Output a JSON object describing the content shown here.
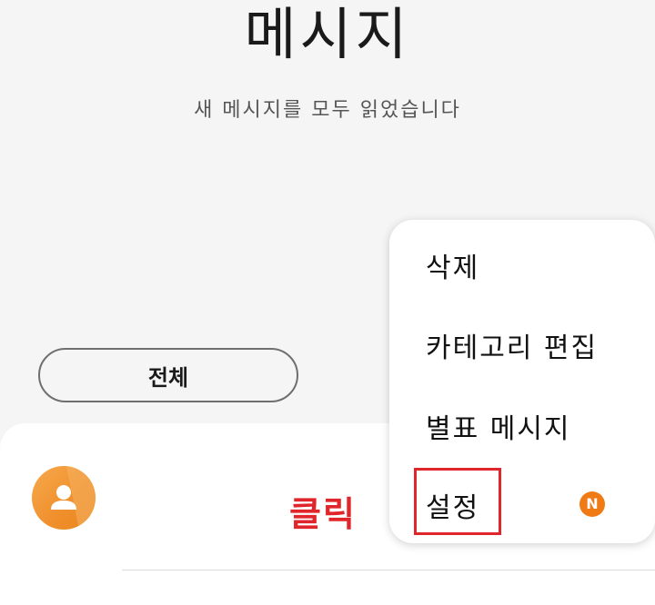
{
  "header": {
    "title": "메시지",
    "subtitle": "새 메시지를 모두 읽었습니다"
  },
  "filter": {
    "label": "전체"
  },
  "annotation": {
    "click_label": "클릭",
    "highlight_color": "#e0262a"
  },
  "menu": {
    "items": [
      {
        "label": "삭제"
      },
      {
        "label": "카테고리 편집"
      },
      {
        "label": "별표 메시지"
      },
      {
        "label": "설정",
        "badge": "N"
      }
    ]
  },
  "colors": {
    "background": "#f5f5f5",
    "avatar": "#f08f2c",
    "badge": "#f07a14"
  },
  "icons": {
    "avatar": "person-icon"
  }
}
